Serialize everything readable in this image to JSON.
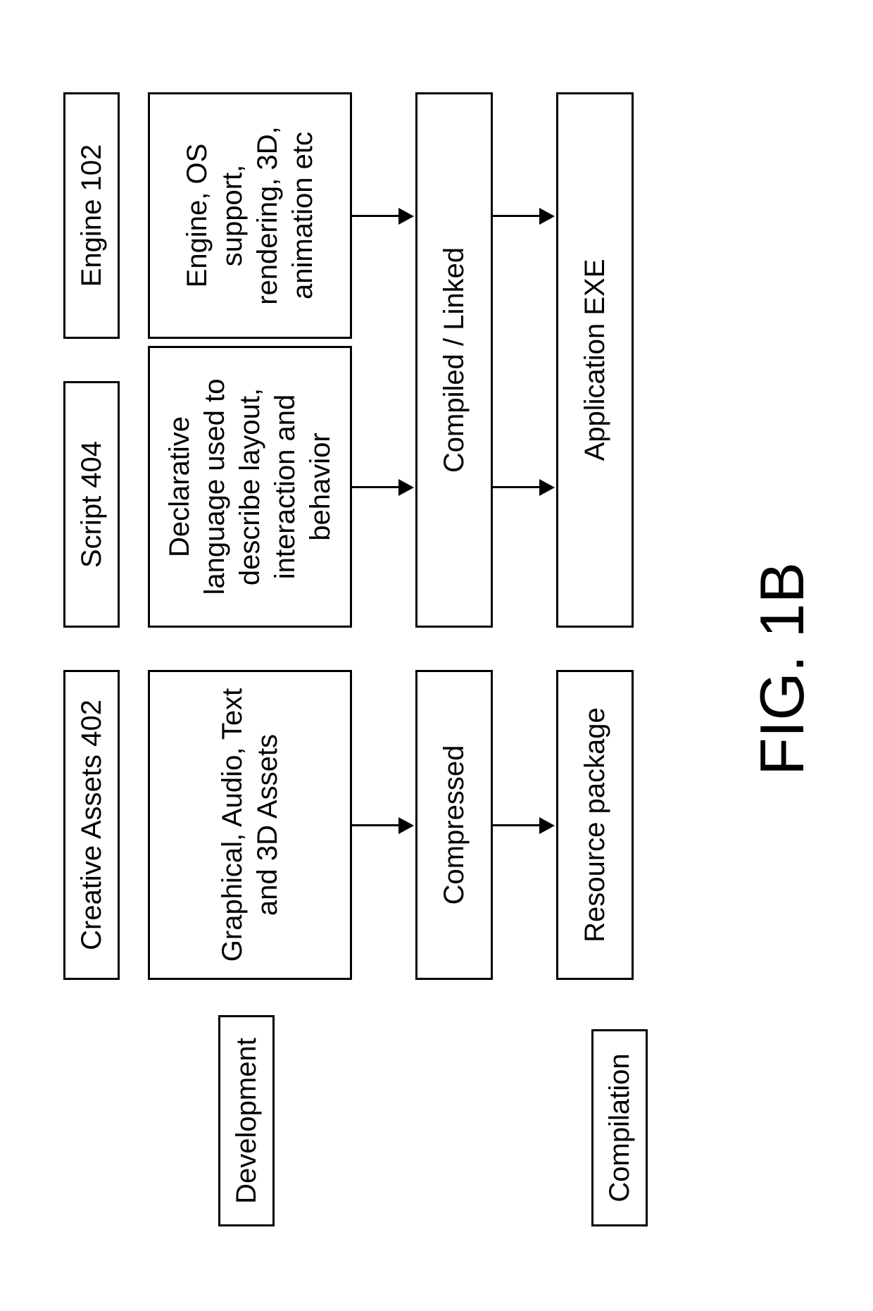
{
  "labels": {
    "development": "Development",
    "compilation": "Compilation"
  },
  "headers": {
    "assets": "Creative Assets 402",
    "script": "Script 404",
    "engine": "Engine 102"
  },
  "dev": {
    "assets": "Graphical, Audio, Text and 3D Assets",
    "script": "Declarative language used to describe layout, interaction and behavior",
    "engine": "Engine, OS support, rendering, 3D, animation etc"
  },
  "mid": {
    "compressed": "Compressed",
    "compiled": "Compiled / Linked"
  },
  "out": {
    "resource": "Resource package",
    "app": "Application EXE"
  },
  "figure": "FIG. 1B"
}
